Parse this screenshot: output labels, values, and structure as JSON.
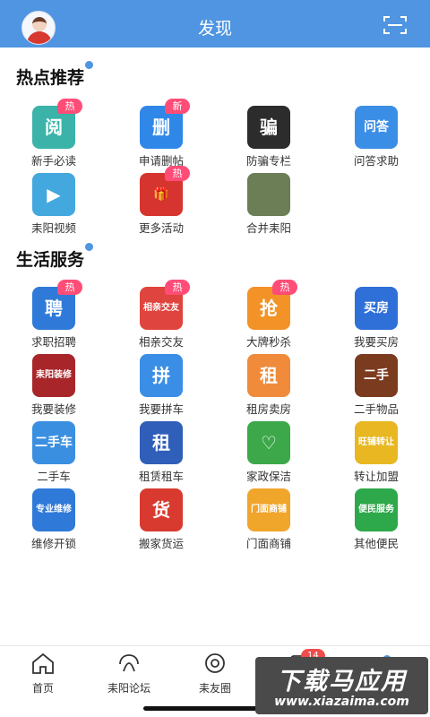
{
  "header": {
    "title": "发现",
    "avatar": "user-avatar",
    "scan_icon": "scan-icon",
    "color": "#4f95e1"
  },
  "sections": [
    {
      "title": "热点推荐",
      "items": [
        {
          "label": "新手必读",
          "icon": "book-icon",
          "glyph": "阅",
          "badge": "热",
          "color": "#3bb3a9"
        },
        {
          "label": "申请删帖",
          "icon": "delete-post-icon",
          "glyph": "删",
          "badge": "新",
          "color": "#2f88e8"
        },
        {
          "label": "防骗专栏",
          "icon": "anti-fraud-icon",
          "glyph": "骗",
          "badge": "",
          "color": "#2c2c2c"
        },
        {
          "label": "问答求助",
          "icon": "qa-icon",
          "glyph": "问答",
          "badge": "",
          "color": "#3b8ee6"
        },
        {
          "label": "耒阳视频",
          "icon": "video-icon",
          "glyph": "▶",
          "badge": "",
          "color": "#43a8de"
        },
        {
          "label": "更多活动",
          "icon": "gift-icon",
          "glyph": "🎁",
          "badge": "热",
          "color": "#d6352f"
        },
        {
          "label": "合并耒阳",
          "icon": "photo-icon",
          "glyph": "",
          "badge": "",
          "color": "#6b7e55"
        }
      ]
    },
    {
      "title": "生活服务",
      "items": [
        {
          "label": "求职招聘",
          "icon": "recruit-icon",
          "glyph": "聘",
          "badge": "热",
          "color": "#2f7ad8"
        },
        {
          "label": "相亲交友",
          "icon": "dating-icon",
          "glyph": "相亲交友",
          "badge": "热",
          "color": "#e0443e"
        },
        {
          "label": "大牌秒杀",
          "icon": "flash-sale-icon",
          "glyph": "抢",
          "badge": "热",
          "color": "#f29227"
        },
        {
          "label": "我要买房",
          "icon": "buy-house-icon",
          "glyph": "买房",
          "badge": "",
          "color": "#2f6fd8"
        },
        {
          "label": "我要装修",
          "icon": "decoration-icon",
          "glyph": "耒阳装修",
          "badge": "",
          "color": "#a8262a"
        },
        {
          "label": "我要拼车",
          "icon": "carpool-icon",
          "glyph": "拼",
          "badge": "",
          "color": "#3b8ee6"
        },
        {
          "label": "租房卖房",
          "icon": "rent-icon",
          "glyph": "租",
          "badge": "",
          "color": "#ef8b3a"
        },
        {
          "label": "二手物品",
          "icon": "second-hand-icon",
          "glyph": "二手",
          "badge": "",
          "color": "#7b3b1f"
        },
        {
          "label": "二手车",
          "icon": "used-car-icon",
          "glyph": "二手车",
          "badge": "",
          "color": "#3a8fe0"
        },
        {
          "label": "租赁租车",
          "icon": "truck-rental-icon",
          "glyph": "租",
          "badge": "",
          "color": "#2f5fb8"
        },
        {
          "label": "家政保洁",
          "icon": "housekeeping-icon",
          "glyph": "♡",
          "badge": "",
          "color": "#3da84a"
        },
        {
          "label": "转让加盟",
          "icon": "franchise-icon",
          "glyph": "旺铺转让",
          "badge": "",
          "color": "#e8b722"
        },
        {
          "label": "维修开锁",
          "icon": "repair-icon",
          "glyph": "专业维修",
          "badge": "",
          "color": "#2f7ad8"
        },
        {
          "label": "搬家货运",
          "icon": "moving-icon",
          "glyph": "货",
          "badge": "",
          "color": "#d83a2f"
        },
        {
          "label": "门面商铺",
          "icon": "shop-icon",
          "glyph": "门面商铺",
          "badge": "",
          "color": "#f0a52b"
        },
        {
          "label": "其他便民",
          "icon": "convenience-icon",
          "glyph": "便民服务",
          "badge": "",
          "color": "#2da84a"
        }
      ]
    }
  ],
  "tabbar": [
    {
      "label": "首页",
      "icon": "home-icon"
    },
    {
      "label": "耒阳论坛",
      "icon": "forum-icon"
    },
    {
      "label": "耒友圈",
      "icon": "circle-icon"
    },
    {
      "label": "",
      "icon": "message-icon",
      "badge": "14"
    },
    {
      "label": "",
      "icon": "profile-icon"
    }
  ],
  "watermark": {
    "title": "下载马应用",
    "url": "www.xiazaima.com"
  }
}
